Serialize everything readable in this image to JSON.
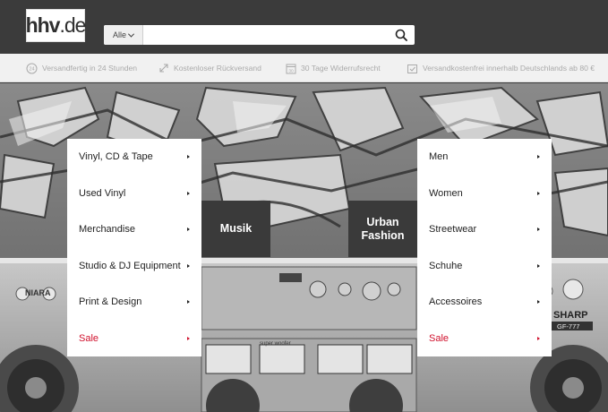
{
  "header": {
    "logo": {
      "main": "hhv",
      "suffix": ".de"
    },
    "search": {
      "scope": "Alle",
      "value": "",
      "placeholder": ""
    }
  },
  "usp": [
    {
      "icon": "clock-24-icon",
      "text": "Versandfertig in 24 Stunden"
    },
    {
      "icon": "return-arrows-icon",
      "text": "Kostenloser Rückversand"
    },
    {
      "icon": "calendar-30-icon",
      "text": "30 Tage Widerrufsrecht"
    },
    {
      "icon": "truck-box-icon",
      "text": "Versandkostenfrei innerhalb Deutschlands ab 80 €"
    }
  ],
  "menus": {
    "musik": {
      "label": "Musik",
      "items": [
        {
          "label": "Vinyl, CD & Tape"
        },
        {
          "label": "Used Vinyl"
        },
        {
          "label": "Merchandise"
        },
        {
          "label": "Studio & DJ Equipment"
        },
        {
          "label": "Print & Design"
        },
        {
          "label": "Sale"
        }
      ]
    },
    "fashion": {
      "label_line1": "Urban",
      "label_line2": "Fashion",
      "items": [
        {
          "label": "Men"
        },
        {
          "label": "Women"
        },
        {
          "label": "Streetwear"
        },
        {
          "label": "Schuhe"
        },
        {
          "label": "Accessoires"
        },
        {
          "label": "Sale"
        }
      ]
    }
  },
  "hero": {
    "ghetto_blaster_labels": [
      "SHARP",
      "GF-777",
      "super woofer",
      "NIARA"
    ]
  },
  "colors": {
    "header_bg": "#3b3b3b",
    "sale_red": "#d0102c",
    "label_bg": "#3a3a3a",
    "usp_bg": "#f1f1f1"
  }
}
